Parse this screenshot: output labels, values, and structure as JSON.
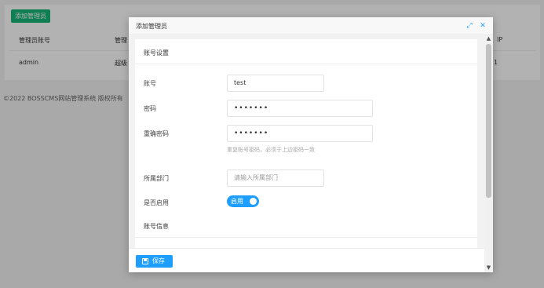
{
  "background": {
    "add_button": "添加管理员",
    "table": {
      "headers": [
        "管理员账号",
        "管理",
        "IP"
      ],
      "row": [
        "admin",
        "超级",
        "1"
      ]
    },
    "footer": "©2022 BOSSCMS网站管理系统 版权所有"
  },
  "dialog": {
    "title": "添加管理员",
    "icons": [
      "expand-icon",
      "close-icon"
    ],
    "section_account_settings": "账号设置",
    "fields": {
      "account": {
        "label": "账号",
        "value": "test"
      },
      "password": {
        "label": "密码",
        "value": "•••••••"
      },
      "confirm_password": {
        "label": "重确密码",
        "value": "•••••••",
        "help": "重复账号密码，必须于上边密码一致"
      },
      "department": {
        "label": "所属部门",
        "placeholder": "请输入所属部门"
      },
      "enabled": {
        "label": "是否启用",
        "toggle_text": "启用",
        "state": "on"
      }
    },
    "section_account_info": "账号信息",
    "save_label": "保存"
  },
  "colors": {
    "primary": "#1e9fff",
    "green": "#16b777",
    "overlay": "rgba(0,0,0,0.30)"
  }
}
